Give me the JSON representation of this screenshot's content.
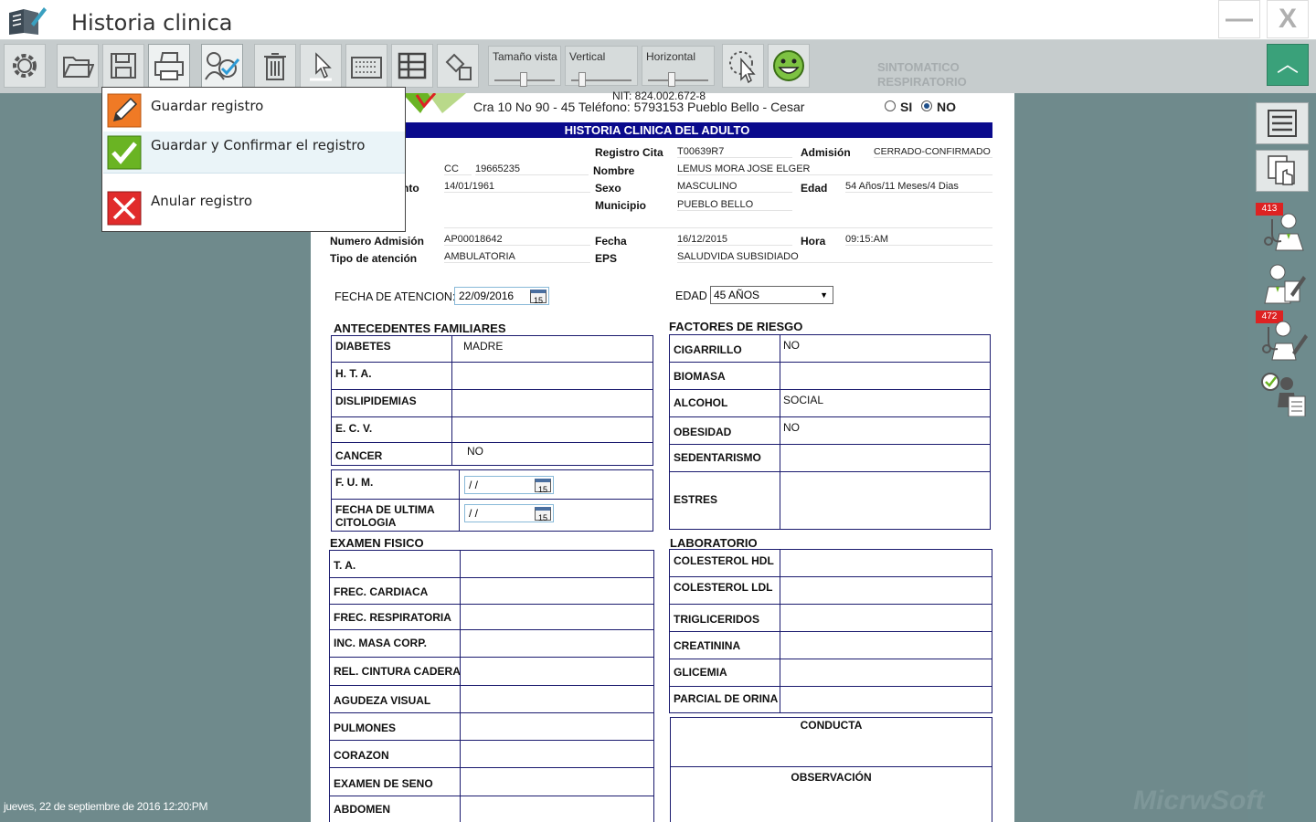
{
  "window": {
    "title": "Historia clinica",
    "minimize": "—",
    "close": "X"
  },
  "toolbar": {
    "sliders": [
      {
        "label": "Tamaño vista",
        "level": 0.5
      },
      {
        "label": "Vertical",
        "level": 0.25
      },
      {
        "label": "Horizontal",
        "level": 0.5
      }
    ],
    "collapse": "︿",
    "ghost_text": [
      "SINTOMATICO",
      "RESPIRATORIO"
    ]
  },
  "menu": {
    "items": [
      {
        "label": "Guardar registro",
        "icon": "edit-icon",
        "color": "#f07a25"
      },
      {
        "label": "Guardar y Confirmar el registro",
        "icon": "check-icon",
        "color": "#6ab423"
      },
      {
        "label": "Anular registro",
        "icon": "cancel-icon",
        "color": "#e12b2b"
      }
    ]
  },
  "doc": {
    "nit": "NIT: 824.002.672-8",
    "address": "Cra 10 No 90 - 45 Teléfono: 5793153 Pueblo Bello - Cesar",
    "radio_si": "SI",
    "radio_no": "NO",
    "radio_selected": "NO",
    "banner": "HISTORIA CLINICA DEL ADULTO",
    "registro_cita_label": "Registro Cita",
    "registro_cita": "T00639R7",
    "admision_label": "Admisión",
    "admision": "CERRADO-CONFIRMADO",
    "id_type": "CC",
    "id_number": "19665235",
    "nombre_label": "Nombre",
    "nombre": "LEMUS MORA JOSE ELGER",
    "nacimiento_label": "nto",
    "nacimiento": "14/01/1961",
    "sexo_label": "Sexo",
    "sexo": "MASCULINO",
    "edad_label": "Edad",
    "edad": "54 Años/11 Meses/4 Dias",
    "municipio_label": "Municipio",
    "municipio": "PUEBLO BELLO",
    "num_admision_label": "Numero Admisión",
    "num_admision": "AP00018642",
    "fecha_label": "Fecha",
    "fecha": "16/12/2015",
    "hora_label": "Hora",
    "hora": "09:15:AM",
    "tipo_atencion_label": "Tipo de atención",
    "tipo_atencion": "AMBULATORIA",
    "eps_label": "EPS",
    "eps": "SALUDVIDA SUBSIDIADO",
    "fecha_atencion_label": "FECHA DE ATENCION:",
    "fecha_atencion": "22/09/2016",
    "edad_sel_label": "EDAD",
    "edad_sel": "45 AÑOS",
    "cal_day": "15",
    "empty_date": " /  /"
  },
  "antecedentes": {
    "title": "ANTECEDENTES FAMILIARES",
    "rows": [
      {
        "label": "DIABETES",
        "value": "MADRE"
      },
      {
        "label": "H. T. A.",
        "value": ""
      },
      {
        "label": "DISLIPIDEMIAS",
        "value": ""
      },
      {
        "label": "E. C. V.",
        "value": ""
      },
      {
        "label": "CANCER",
        "value": "NO"
      }
    ],
    "fum_label": "F. U. M.",
    "citologia_label": "FECHA  DE ULTIMA CITOLOGIA"
  },
  "riesgo": {
    "title": "FACTORES DE RIESGO",
    "rows": [
      {
        "label": "CIGARRILLO",
        "value": "NO"
      },
      {
        "label": "BIOMASA",
        "value": ""
      },
      {
        "label": "ALCOHOL",
        "value": "SOCIAL"
      },
      {
        "label": "OBESIDAD",
        "value": "NO"
      },
      {
        "label": "SEDENTARISMO",
        "value": ""
      },
      {
        "label": "ESTRES",
        "value": ""
      }
    ]
  },
  "examen": {
    "title": "EXAMEN FISICO",
    "rows": [
      "T. A.",
      "FREC. CARDIACA",
      "FREC. RESPIRATORIA",
      "INC. MASA  CORP.",
      "REL. CINTURA CADERA",
      "AGUDEZA VISUAL",
      "PULMONES",
      "CORAZON",
      "EXAMEN DE SENO",
      "ABDOMEN"
    ]
  },
  "laboratorio": {
    "title": "LABORATORIO",
    "rows": [
      "COLESTEROL  HDL",
      "COLESTEROL LDL",
      "TRIGLICERIDOS",
      "CREATININA",
      "GLICEMIA",
      "PARCIAL DE ORINA"
    ]
  },
  "conducta": "CONDUCTA",
  "observacion": "OBSERVACIÓN",
  "sidebar": {
    "badge_1": "413",
    "badge_2": "472"
  },
  "status": {
    "datetime": "jueves, 22 de septiembre de 2016 12:20:PM"
  },
  "watermark": "MicrwSoft"
}
